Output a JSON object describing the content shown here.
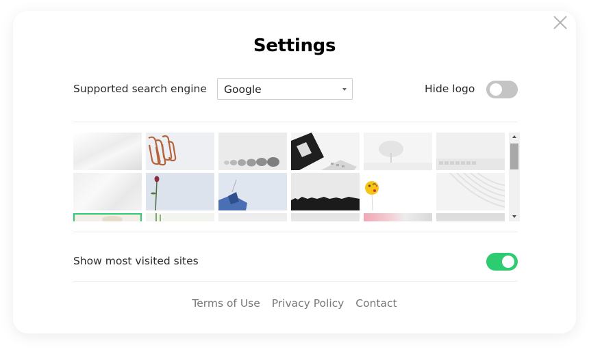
{
  "dialog": {
    "title": "Settings"
  },
  "search_engine": {
    "label": "Supported search engine",
    "selected": "Google"
  },
  "hide_logo": {
    "label": "Hide logo",
    "enabled": false
  },
  "wallpapers": [
    {
      "name": "white-fabric-wallpaper"
    },
    {
      "name": "paperclips-wallpaper"
    },
    {
      "name": "stones-wallpaper"
    },
    {
      "name": "desk-keyboard-wallpaper"
    },
    {
      "name": "snow-tree-wallpaper"
    },
    {
      "name": "keyboard-wallpaper"
    },
    {
      "name": "marble-wallpaper"
    },
    {
      "name": "rose-wallpaper"
    },
    {
      "name": "blue-objects-wallpaper"
    },
    {
      "name": "treeline-wallpaper"
    },
    {
      "name": "emoji-balloon-wallpaper"
    },
    {
      "name": "white-lines-wallpaper"
    }
  ],
  "most_visited": {
    "label": "Show most visited sites",
    "enabled": true
  },
  "footer": {
    "links": [
      "Terms of Use",
      "Privacy Policy",
      "Contact"
    ]
  },
  "colors": {
    "accent": "#2ecc71",
    "toggle_off": "#c4c4c4"
  }
}
